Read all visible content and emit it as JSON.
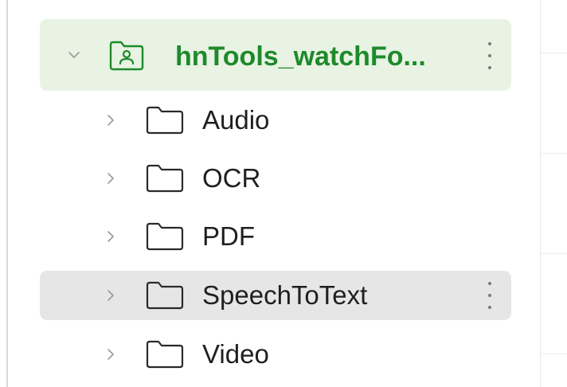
{
  "colors": {
    "root_bg": "#e8f3e4",
    "root_text": "#1e8a2a",
    "selected_bg": "#e6e6e6"
  },
  "tree": {
    "root": {
      "label": "hnTools_watchFo...",
      "icon": "shared-folder-icon",
      "expanded": true
    },
    "children": [
      {
        "label": "Audio",
        "icon": "folder-icon",
        "selected": false
      },
      {
        "label": "OCR",
        "icon": "folder-icon",
        "selected": false
      },
      {
        "label": "PDF",
        "icon": "folder-icon",
        "selected": false
      },
      {
        "label": "SpeechToText",
        "icon": "folder-icon",
        "selected": true
      },
      {
        "label": "Video",
        "icon": "folder-icon",
        "selected": false
      }
    ]
  }
}
